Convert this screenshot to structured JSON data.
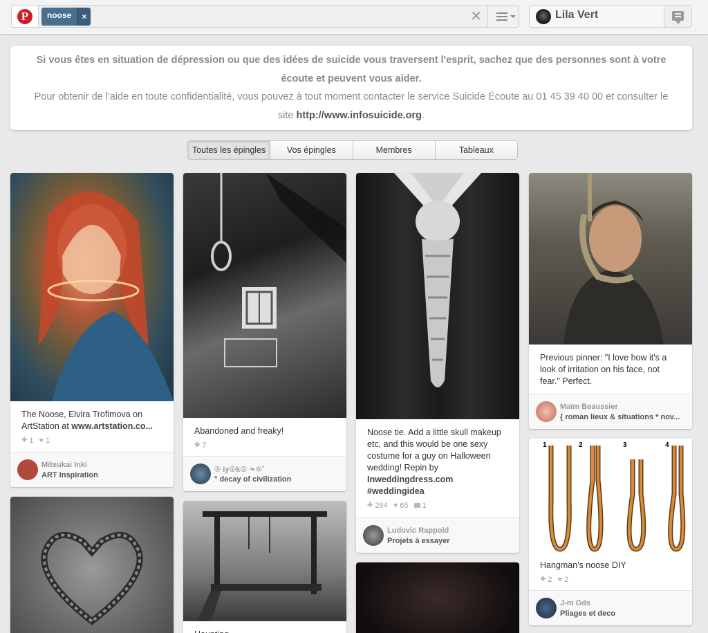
{
  "header": {
    "logo_letter": "P",
    "search_token": "noose",
    "token_remove": "×",
    "clear_search": "✕",
    "user_name": "Lila Vert"
  },
  "notice": {
    "line1": "Si vous êtes en situation de dépression ou que des idées de suicide vous traversent l'esprit, sachez que des personnes sont à votre écoute et peuvent vous aider.",
    "line2_text": "Pour obtenir de l'aide en toute confidentialité, vous pouvez à tout moment contacter le service Suicide Écoute au 01 45 39 40 00 et consulter le site",
    "link": "http://www.infosuicide.org",
    "line2_end": "."
  },
  "tabs": [
    {
      "label": "Toutes les épingles",
      "active": true
    },
    {
      "label": "Vos épingles"
    },
    {
      "label": "Membres"
    },
    {
      "label": "Tableaux"
    }
  ],
  "pins": [
    {
      "desc_text": "The Noose, Elvira Trofimova on ArtStation at ",
      "desc_link": "www.artstation.co...",
      "repins": "1",
      "likes": "1",
      "user": "Mitsukai Inki",
      "board": "ART Inspiration",
      "avatar_color": "#b04a3a"
    },
    {
      "desc_text": "Abandoned and freaky!",
      "repins": "7",
      "user": "✇ iy☮k☮ ❧✲˚",
      "board": "° decay of civilization",
      "avatar_color": "#3b5570"
    },
    {
      "desc_text": "Noose tie. Add a little skull makeup etc, and this would be one sexy costume for a guy on Halloween wedding! Repin by ",
      "desc_link": "Inweddingdress.com #weddingidea",
      "repins": "264",
      "likes": "65",
      "comments": "1",
      "user": "Ludovic Rappold",
      "board": "Projets à essayer",
      "avatar_color": "#6b6b6b"
    },
    {
      "desc_text": "Previous pinner: \"I love how it's a look of irritation on his face, not fear.\" Perfect.",
      "user": "Maïm Beaussier",
      "board": "{ roman lieux & situations * nov...",
      "avatar_color": "#d9a08a"
    },
    {
      "desc_text": "Hangman's noose DIY",
      "repins": "2",
      "likes": "2",
      "user": "J-m Gds",
      "board": "Pliages et deco",
      "avatar_color": "#2e4a6a",
      "knot_numbers": [
        "1",
        "2",
        "3",
        "4"
      ]
    },
    {
      "desc_text": "Haunting"
    }
  ]
}
